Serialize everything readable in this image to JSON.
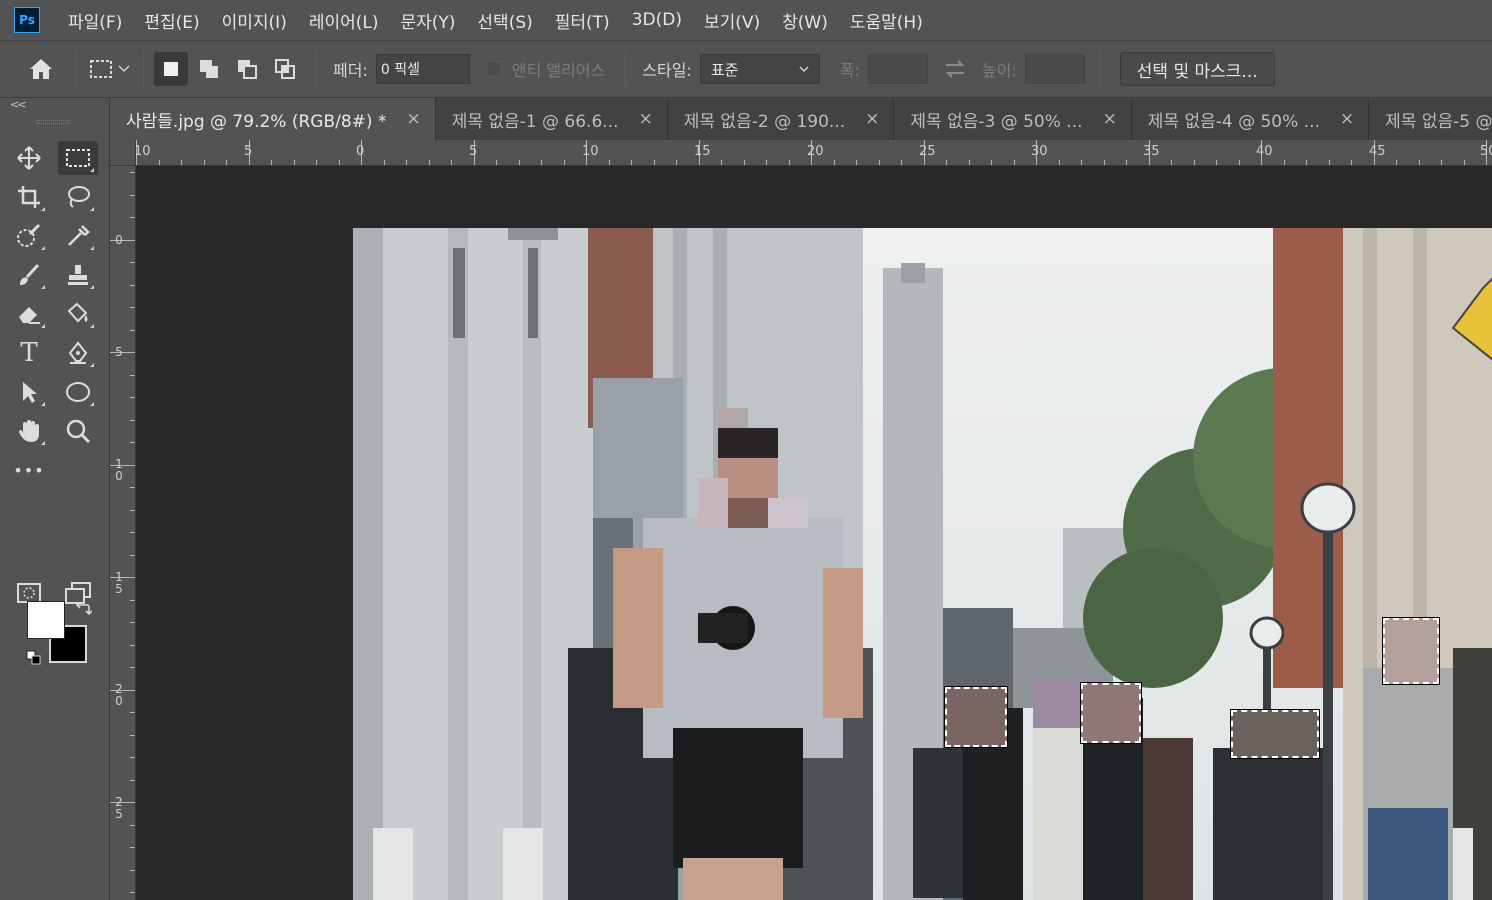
{
  "app": {
    "logo": "Ps"
  },
  "menu": [
    "파일(F)",
    "편집(E)",
    "이미지(I)",
    "레이어(L)",
    "문자(Y)",
    "선택(S)",
    "필터(T)",
    "3D(D)",
    "보기(V)",
    "창(W)",
    "도움말(H)"
  ],
  "options": {
    "feather_label": "페더:",
    "feather_value": "0 픽셀",
    "antialias_label": "앤티 앨리어스",
    "style_label": "스타일:",
    "style_value": "표준",
    "width_label": "폭:",
    "height_label": "높이:",
    "select_mask_button": "선택 및 마스크..."
  },
  "tabs": [
    {
      "label": "사람들.jpg @ 79.2% (RGB/8#) *",
      "close": "×"
    },
    {
      "label": "제목 없음-1 @ 66.6...",
      "close": "×"
    },
    {
      "label": "제목 없음-2 @ 190...",
      "close": "×"
    },
    {
      "label": "제목 없음-3 @ 50% ...",
      "close": "×"
    },
    {
      "label": "제목 없음-4 @ 50% ...",
      "close": "×"
    },
    {
      "label": "제목 없음-5 @",
      "close": ""
    }
  ],
  "ruler": {
    "horizontal": [
      "10",
      "5",
      "0",
      "5",
      "10",
      "15",
      "20",
      "25",
      "30",
      "35",
      "40",
      "45",
      "50"
    ],
    "vertical": [
      "0",
      "5",
      "10",
      "15",
      "20",
      "25"
    ]
  },
  "toolbar": {
    "collapse": "<<",
    "tools": [
      "move-tool",
      "marquee-tool",
      "crop-tool",
      "lasso-tool",
      "quick-select-tool",
      "eyedropper-tool",
      "brush-tool",
      "stamp-tool",
      "eraser-tool",
      "paint-bucket-tool",
      "type-tool",
      "pen-tool",
      "path-select-tool",
      "ellipse-tool",
      "hand-tool",
      "zoom-tool",
      "more-tools"
    ],
    "more_label": "•••",
    "type_label": "T"
  },
  "colors": {
    "foreground": "#ffffff",
    "background": "#000000",
    "accent": "#31a8ff"
  }
}
